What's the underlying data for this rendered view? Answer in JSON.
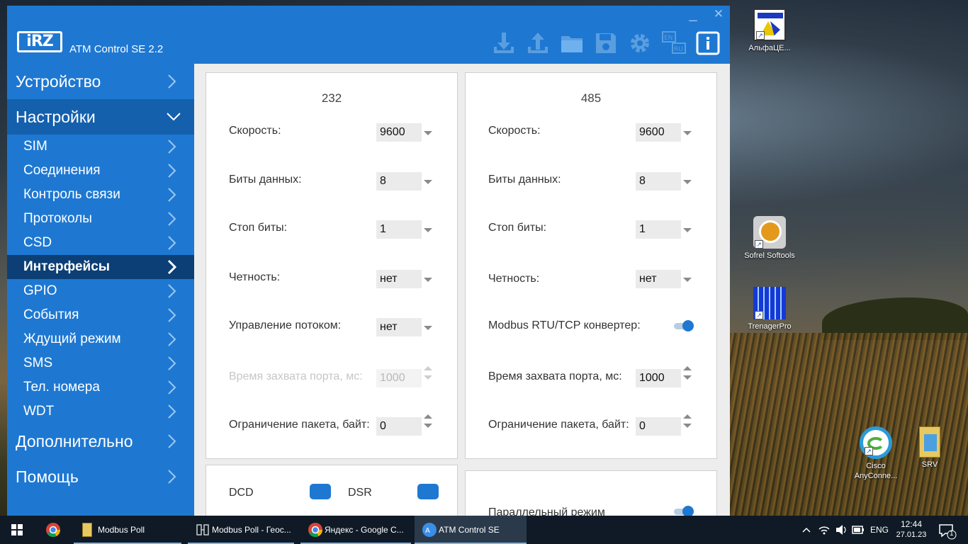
{
  "app": {
    "title": "ATM Control SE 2.2",
    "logo_text": "iRZ",
    "window_controls": {
      "minimize": "_",
      "close": "✕"
    },
    "toolbar": [
      {
        "name": "download-icon"
      },
      {
        "name": "upload-icon"
      },
      {
        "name": "folder-icon"
      },
      {
        "name": "save-icon"
      },
      {
        "name": "gear-icon"
      },
      {
        "name": "language-icon",
        "top": "EN",
        "bottom": "RU"
      },
      {
        "name": "info-icon"
      }
    ]
  },
  "sidebar": {
    "top_items": [
      {
        "label": "Устройство"
      },
      {
        "label": "Настройки"
      },
      {
        "label": "Дополнительно"
      },
      {
        "label": "Помощь"
      }
    ],
    "sub_items": [
      {
        "label": "SIM"
      },
      {
        "label": "Соединения"
      },
      {
        "label": "Контроль связи"
      },
      {
        "label": "Протоколы"
      },
      {
        "label": "CSD"
      },
      {
        "label": "Интерфейсы"
      },
      {
        "label": "GPIO"
      },
      {
        "label": "События"
      },
      {
        "label": "Ждущий режим"
      },
      {
        "label": "SMS"
      },
      {
        "label": "Тел. номера"
      },
      {
        "label": "WDT"
      }
    ]
  },
  "panel232": {
    "title": "232",
    "speed_label": "Скорость:",
    "speed_value": "9600",
    "databits_label": "Биты данных:",
    "databits_value": "8",
    "stopbits_label": "Стоп биты:",
    "stopbits_value": "1",
    "parity_label": "Четность:",
    "parity_value": "нет",
    "flow_label": "Управление потоком:",
    "flow_value": "нет",
    "capture_label": "Время захвата порта, мс:",
    "capture_value": "1000",
    "packet_label": "Ограничение пакета, байт:",
    "packet_value": "0"
  },
  "panel485": {
    "title": "485",
    "speed_label": "Скорость:",
    "speed_value": "9600",
    "databits_label": "Биты данных:",
    "databits_value": "8",
    "stopbits_label": "Стоп биты:",
    "stopbits_value": "1",
    "parity_label": "Четность:",
    "parity_value": "нет",
    "modbus_label": "Modbus RTU/TCP конвертер:",
    "capture_label": "Время захвата порта, мс:",
    "capture_value": "1000",
    "packet_label": "Ограничение пакета, байт:",
    "packet_value": "0"
  },
  "signals": {
    "dcd": "DCD",
    "dsr": "DSR"
  },
  "parallel": {
    "label": "Параллельный режим"
  },
  "desktop_icons": [
    {
      "label": "АльфаЦЕ..."
    },
    {
      "label": "Sofrel Softools"
    },
    {
      "label": "TrenagerPro"
    },
    {
      "label": "Cisco AnyConne..."
    },
    {
      "label": "SRV"
    }
  ],
  "taskbar": {
    "items": [
      {
        "label": "Modbus Poll"
      },
      {
        "label": "Modbus Poll - Геос..."
      },
      {
        "label": "Яндекс - Google C..."
      },
      {
        "label": "ATM Control SE"
      }
    ],
    "lang": "ENG",
    "time": "12:44",
    "date": "27.01.23",
    "notifications": "1"
  },
  "colors": {
    "accent": "#1e78d2",
    "active_nav": "#0b3f76",
    "taskbar": "#0f1a26"
  }
}
